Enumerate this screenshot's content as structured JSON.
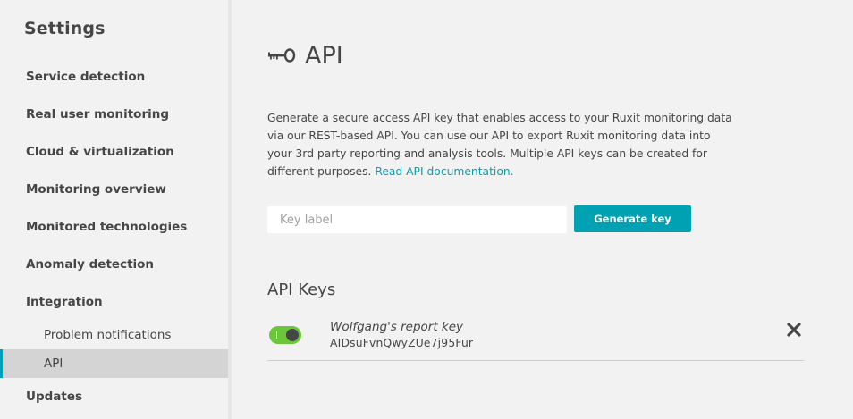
{
  "sidebar": {
    "title": "Settings",
    "items": [
      {
        "label": "Service detection"
      },
      {
        "label": "Real user monitoring"
      },
      {
        "label": "Cloud & virtualization"
      },
      {
        "label": "Monitoring overview"
      },
      {
        "label": "Monitored technologies"
      },
      {
        "label": "Anomaly detection"
      },
      {
        "label": "Integration"
      }
    ],
    "subitems": [
      {
        "label": "Problem notifications"
      },
      {
        "label": "API",
        "active": true
      }
    ],
    "last_item": {
      "label": "Updates"
    }
  },
  "page": {
    "title": "API",
    "icon": "key-icon",
    "description": "Generate a secure access API key that enables access to your Ruxit monitoring data via our REST-based API. You can use our API to export Ruxit monitoring data into your 3rd party reporting and analysis tools. Multiple API keys can be created for different purposes.",
    "doc_link": "Read API documentation."
  },
  "form": {
    "key_label_placeholder": "Key label",
    "generate_button": "Generate key"
  },
  "api_keys": {
    "title": "API Keys",
    "items": [
      {
        "name": "Wolfgang's report key",
        "value": "AIDsuFvnQwyZUe7j95Fur",
        "enabled": true
      }
    ]
  },
  "colors": {
    "accent": "#00a1b2",
    "toggle_on": "#6bc63a",
    "text": "#454646",
    "panel": "#f2f2f2",
    "active_item": "#d4d4d4"
  }
}
